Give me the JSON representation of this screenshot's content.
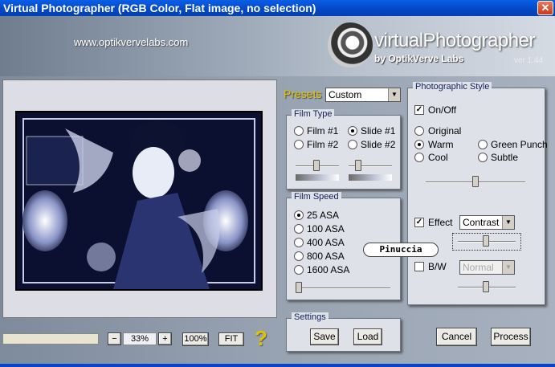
{
  "window": {
    "title": "Virtual Photographer (RGB Color, Flat image, no selection)"
  },
  "header": {
    "url": "www.optikvervelabs.com",
    "logo_text": "virtualPhotographer",
    "logo_sub": "by OptikVerve Labs",
    "version": "ver 1.44"
  },
  "presets": {
    "label": "Presets",
    "value": "Custom"
  },
  "film_type": {
    "title": "Film Type",
    "options": [
      "Film #1",
      "Slide #1",
      "Film #2",
      "Slide #2"
    ],
    "selected": "Slide #1",
    "film_slider": 0.5,
    "slide_slider": 0.25
  },
  "film_speed": {
    "title": "Film Speed",
    "options": [
      "25 ASA",
      "100 ASA",
      "400 ASA",
      "800 ASA",
      "1600 ASA"
    ],
    "selected": "25 ASA",
    "slider": 0.0
  },
  "settings": {
    "title": "Settings",
    "save": "Save",
    "load": "Load"
  },
  "photographic_style": {
    "title": "Photographic Style",
    "on_off": "On/Off",
    "on_off_checked": true,
    "styles": [
      "Original",
      "Warm",
      "Green Punch",
      "Cool",
      "Subtle"
    ],
    "selected": "Warm",
    "slider": 0.5,
    "effect_label": "Effect",
    "effect_checked": true,
    "effect_value": "Contrast",
    "effect_slider": 0.5,
    "bw_label": "B/W",
    "bw_checked": false,
    "bw_value": "Normal",
    "bw_slider": 0.5
  },
  "watermark": "Pinuccia",
  "zoom": {
    "minus": "−",
    "value": "33%",
    "plus": "+",
    "hundred": "100%",
    "fit": "FIT",
    "help": "?"
  },
  "actions": {
    "cancel": "Cancel",
    "process": "Process"
  },
  "colors": {
    "title_bar": "#0447c4",
    "accent_presets": "#e0c300"
  }
}
